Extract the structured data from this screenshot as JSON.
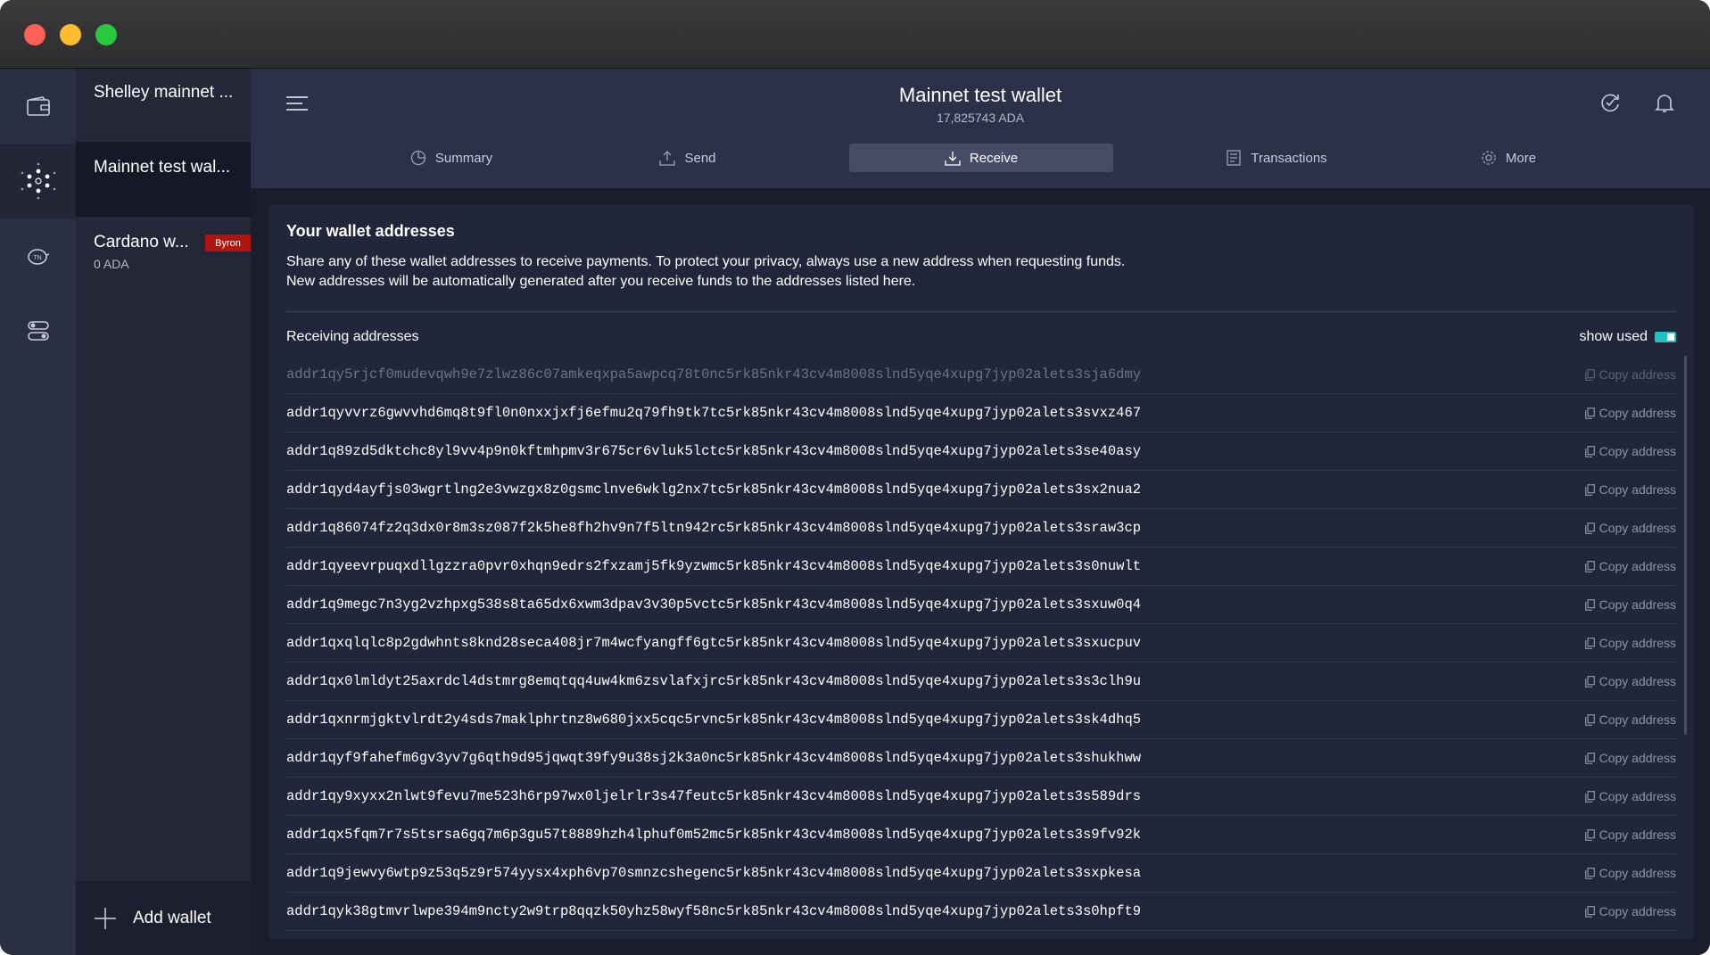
{
  "app": {
    "wallet_title": "Mainnet test wallet",
    "wallet_amount": "17,825743 ADA"
  },
  "sidebar": {
    "header_name": "Shelley mainnet ...",
    "wallets": [
      {
        "name": "Mainnet test wal...",
        "balance": ""
      },
      {
        "name": "Cardano w...",
        "balance": "0 ADA",
        "badge": "Byron"
      }
    ],
    "add_wallet_label": "Add wallet"
  },
  "tabs": [
    {
      "label": "Summary",
      "icon": "summary-icon"
    },
    {
      "label": "Send",
      "icon": "send-icon"
    },
    {
      "label": "Receive",
      "icon": "receive-icon",
      "active": true
    },
    {
      "label": "Transactions",
      "icon": "transactions-icon"
    },
    {
      "label": "More",
      "icon": "gear-icon"
    }
  ],
  "receive": {
    "title": "Your wallet addresses",
    "description_line1": "Share any of these wallet addresses to receive payments. To protect your privacy, always use a new address when requesting funds.",
    "description_line2": "New addresses will be automatically generated after you receive funds to the addresses listed here.",
    "receiving_label": "Receiving addresses",
    "show_used_label": "show used",
    "show_used_enabled": true,
    "copy_label": "Copy address",
    "accent_color": "#1fc1c3",
    "addresses": [
      {
        "address": "addr1qy5rjcf0mudevqwh9e7zlwz86c07amkeqxpa5awpcq78t0nc5rk85nkr43cv4m8008slnd5yqe4xupg7jyp02alets3sja6dmy",
        "used": true
      },
      {
        "address": "addr1qyvvrz6gwvvhd6mq8t9fl0n0nxxjxfj6efmu2q79fh9tk7tc5rk85nkr43cv4m8008slnd5yqe4xupg7jyp02alets3svxz467",
        "used": false
      },
      {
        "address": "addr1q89zd5dktchc8yl9vv4p9n0kftmhpmv3r675cr6vluk5lctc5rk85nkr43cv4m8008slnd5yqe4xupg7jyp02alets3se40asy",
        "used": false
      },
      {
        "address": "addr1qyd4ayfjs03wgrtlng2e3vwzgx8z0gsmclnve6wklg2nx7tc5rk85nkr43cv4m8008slnd5yqe4xupg7jyp02alets3sx2nua2",
        "used": false
      },
      {
        "address": "addr1q86074fz2q3dx0r8m3sz087f2k5he8fh2hv9n7f5ltn942rc5rk85nkr43cv4m8008slnd5yqe4xupg7jyp02alets3sraw3cp",
        "used": false
      },
      {
        "address": "addr1qyeevrpuqxdllgzzra0pvr0xhqn9edrs2fxzamj5fk9yzwmc5rk85nkr43cv4m8008slnd5yqe4xupg7jyp02alets3s0nuwlt",
        "used": false
      },
      {
        "address": "addr1q9megc7n3yg2vzhpxg538s8ta65dx6xwm3dpav3v30p5vctc5rk85nkr43cv4m8008slnd5yqe4xupg7jyp02alets3sxuw0q4",
        "used": false
      },
      {
        "address": "addr1qxqlqlc8p2gdwhnts8knd28seca408jr7m4wcfyangff6gtc5rk85nkr43cv4m8008slnd5yqe4xupg7jyp02alets3sxucpuv",
        "used": false
      },
      {
        "address": "addr1qx0lmldyt25axrdcl4dstmrg8emqtqq4uw4km6zsvlafxjrc5rk85nkr43cv4m8008slnd5yqe4xupg7jyp02alets3s3clh9u",
        "used": false
      },
      {
        "address": "addr1qxnrmjgktvlrdt2y4sds7maklphrtnz8w680jxx5cqc5rvnc5rk85nkr43cv4m8008slnd5yqe4xupg7jyp02alets3sk4dhq5",
        "used": false
      },
      {
        "address": "addr1qyf9fahefm6gv3yv7g6qth9d95jqwqt39fy9u38sj2k3a0nc5rk85nkr43cv4m8008slnd5yqe4xupg7jyp02alets3shukhww",
        "used": false
      },
      {
        "address": "addr1qy9xyxx2nlwt9fevu7me523h6rp97wx0ljelrlr3s47feutc5rk85nkr43cv4m8008slnd5yqe4xupg7jyp02alets3s589drs",
        "used": false
      },
      {
        "address": "addr1qx5fqm7r7s5tsrsa6gq7m6p3gu57t8889hzh4lphuf0m52mc5rk85nkr43cv4m8008slnd5yqe4xupg7jyp02alets3s9fv92k",
        "used": false
      },
      {
        "address": "addr1q9jewvy6wtp9z53q5z9r574yysx4xph6vp70smnzcshegenc5rk85nkr43cv4m8008slnd5yqe4xupg7jyp02alets3sxpkesa",
        "used": false
      },
      {
        "address": "addr1qyk38gtmvrlwpe394m9ncty2w9trp8qqzk50yhz58wyf58nc5rk85nkr43cv4m8008slnd5yqe4xupg7jyp02alets3s0hpft9",
        "used": false
      }
    ]
  }
}
